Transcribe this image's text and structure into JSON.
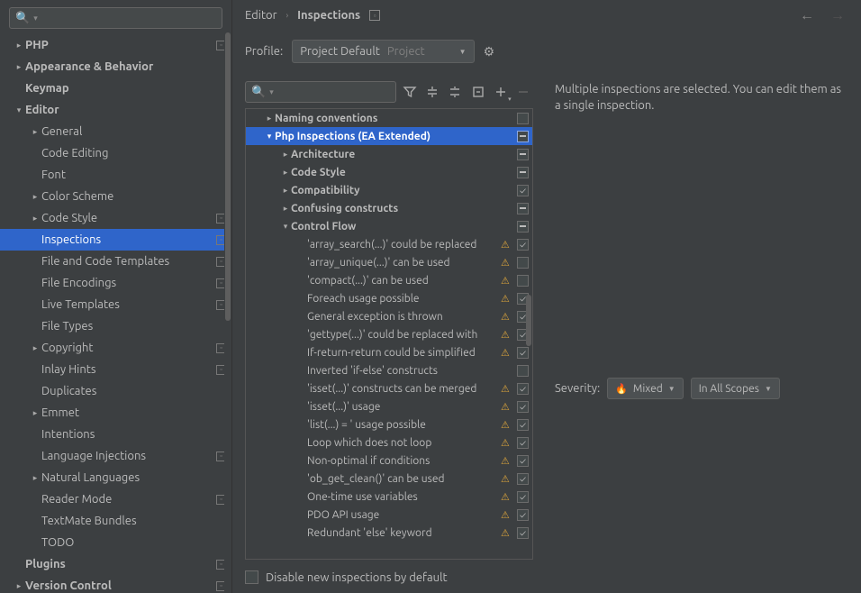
{
  "sidebar": {
    "search_placeholder": "",
    "items": [
      {
        "label": "PHP",
        "depth": 0,
        "arrow": "right",
        "bold": true,
        "badge": true
      },
      {
        "label": "Appearance & Behavior",
        "depth": 0,
        "arrow": "right",
        "bold": true
      },
      {
        "label": "Keymap",
        "depth": 0,
        "arrow": "none",
        "bold": true
      },
      {
        "label": "Editor",
        "depth": 0,
        "arrow": "down",
        "bold": true
      },
      {
        "label": "General",
        "depth": 1,
        "arrow": "right"
      },
      {
        "label": "Code Editing",
        "depth": 1,
        "arrow": "none"
      },
      {
        "label": "Font",
        "depth": 1,
        "arrow": "none"
      },
      {
        "label": "Color Scheme",
        "depth": 1,
        "arrow": "right"
      },
      {
        "label": "Code Style",
        "depth": 1,
        "arrow": "right",
        "badge": true
      },
      {
        "label": "Inspections",
        "depth": 1,
        "arrow": "none",
        "badge": true,
        "selected": true
      },
      {
        "label": "File and Code Templates",
        "depth": 1,
        "arrow": "none",
        "badge": true
      },
      {
        "label": "File Encodings",
        "depth": 1,
        "arrow": "none",
        "badge": true
      },
      {
        "label": "Live Templates",
        "depth": 1,
        "arrow": "none",
        "badge": true
      },
      {
        "label": "File Types",
        "depth": 1,
        "arrow": "none"
      },
      {
        "label": "Copyright",
        "depth": 1,
        "arrow": "right",
        "badge": true
      },
      {
        "label": "Inlay Hints",
        "depth": 1,
        "arrow": "none",
        "badge": true
      },
      {
        "label": "Duplicates",
        "depth": 1,
        "arrow": "none"
      },
      {
        "label": "Emmet",
        "depth": 1,
        "arrow": "right"
      },
      {
        "label": "Intentions",
        "depth": 1,
        "arrow": "none"
      },
      {
        "label": "Language Injections",
        "depth": 1,
        "arrow": "none",
        "badge": true
      },
      {
        "label": "Natural Languages",
        "depth": 1,
        "arrow": "right"
      },
      {
        "label": "Reader Mode",
        "depth": 1,
        "arrow": "none",
        "badge": true
      },
      {
        "label": "TextMate Bundles",
        "depth": 1,
        "arrow": "none"
      },
      {
        "label": "TODO",
        "depth": 1,
        "arrow": "none"
      },
      {
        "label": "Plugins",
        "depth": 0,
        "arrow": "none",
        "bold": true,
        "badge": true
      },
      {
        "label": "Version Control",
        "depth": 0,
        "arrow": "right",
        "bold": true,
        "badge": true
      }
    ]
  },
  "breadcrumb": {
    "a": "Editor",
    "b": "Inspections"
  },
  "profile": {
    "label": "Profile:",
    "value": "Project Default",
    "sub": "Project"
  },
  "inspections": [
    {
      "label": "Naming conventions",
      "depth": 0,
      "arrow": "right",
      "bold": true,
      "check": "empty"
    },
    {
      "label": "Php Inspections (EA Extended)",
      "depth": 0,
      "arrow": "down",
      "bold": true,
      "check": "mixed",
      "selected": true
    },
    {
      "label": "Architecture",
      "depth": 1,
      "arrow": "right",
      "bold": true,
      "check": "mixed"
    },
    {
      "label": "Code Style",
      "depth": 1,
      "arrow": "right",
      "bold": true,
      "check": "mixed"
    },
    {
      "label": "Compatibility",
      "depth": 1,
      "arrow": "right",
      "bold": true,
      "check": "checked"
    },
    {
      "label": "Confusing constructs",
      "depth": 1,
      "arrow": "right",
      "bold": true,
      "check": "mixed"
    },
    {
      "label": "Control Flow",
      "depth": 1,
      "arrow": "down",
      "bold": true,
      "check": "mixed"
    },
    {
      "label": "'array_search(...)' could be replaced",
      "depth": 2,
      "warn": true,
      "check": "checked"
    },
    {
      "label": "'array_unique(...)' can be used",
      "depth": 2,
      "warn": true,
      "check": "empty"
    },
    {
      "label": "'compact(...)' can be used",
      "depth": 2,
      "warn": true,
      "check": "empty"
    },
    {
      "label": "Foreach usage possible",
      "depth": 2,
      "warn": true,
      "check": "checked"
    },
    {
      "label": "General exception is thrown",
      "depth": 2,
      "warn": true,
      "check": "checked"
    },
    {
      "label": "'gettype(...)' could be replaced with",
      "depth": 2,
      "warn": true,
      "check": "checked"
    },
    {
      "label": "If-return-return could be simplified",
      "depth": 2,
      "warn": true,
      "check": "checked"
    },
    {
      "label": "Inverted 'if-else' constructs",
      "depth": 2,
      "check": "empty"
    },
    {
      "label": "'isset(...)' constructs can be merged",
      "depth": 2,
      "warn": true,
      "check": "checked"
    },
    {
      "label": "'isset(...)' usage",
      "depth": 2,
      "warn": true,
      "check": "checked"
    },
    {
      "label": "'list(...) = ' usage possible",
      "depth": 2,
      "warn": true,
      "check": "checked"
    },
    {
      "label": "Loop which does not loop",
      "depth": 2,
      "warn": true,
      "check": "checked"
    },
    {
      "label": "Non-optimal if conditions",
      "depth": 2,
      "warn": true,
      "check": "checked"
    },
    {
      "label": "'ob_get_clean()' can be used",
      "depth": 2,
      "warn": true,
      "check": "checked"
    },
    {
      "label": "One-time use variables",
      "depth": 2,
      "warn": true,
      "check": "checked"
    },
    {
      "label": "PDO API usage",
      "depth": 2,
      "warn": true,
      "check": "checked"
    },
    {
      "label": "Redundant 'else' keyword",
      "depth": 2,
      "warn": true,
      "check": "checked"
    }
  ],
  "details": {
    "msg": "Multiple inspections are selected. You can edit them as a single inspection."
  },
  "severity": {
    "label": "Severity:",
    "value": "Mixed",
    "scope": "In All Scopes"
  },
  "footer": {
    "disable_label": "Disable new inspections by default"
  }
}
